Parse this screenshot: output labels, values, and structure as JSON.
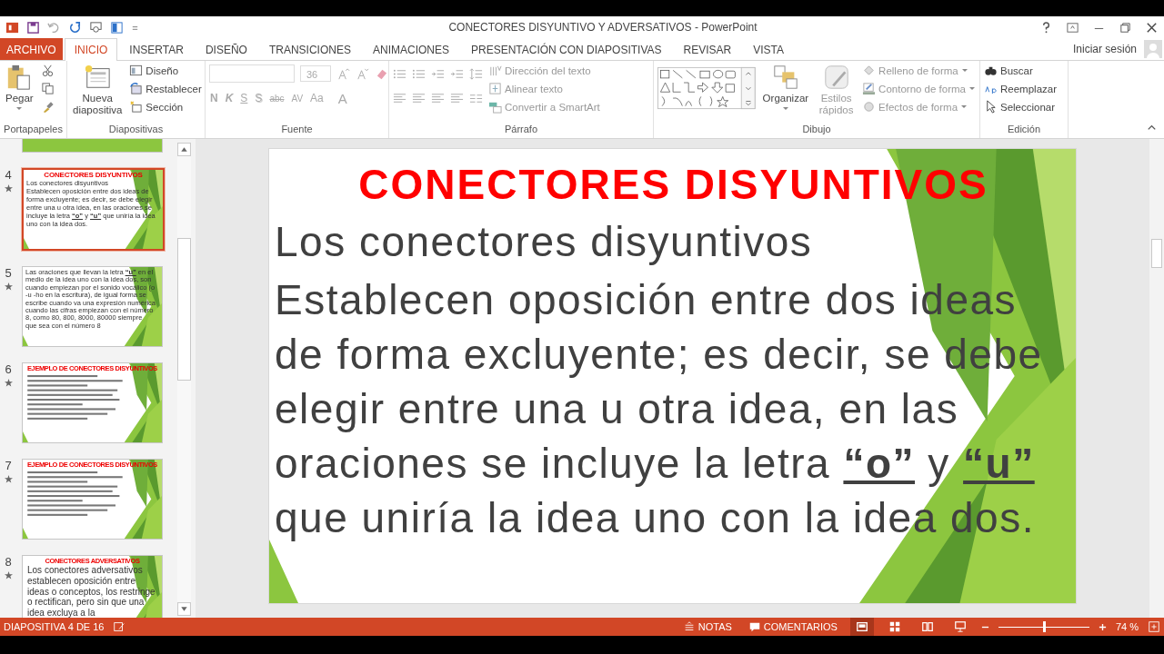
{
  "window": {
    "title": "CONECTORES DISYUNTIVO Y ADVERSATIVOS - PowerPoint",
    "sign_in": "Iniciar sesión"
  },
  "tabs": [
    {
      "label": "ARCHIVO",
      "kind": "file",
      "selected": false
    },
    {
      "label": "INICIO",
      "kind": "tab",
      "selected": true
    },
    {
      "label": "INSERTAR",
      "kind": "tab",
      "selected": false
    },
    {
      "label": "DISEÑO",
      "kind": "tab",
      "selected": false
    },
    {
      "label": "TRANSICIONES",
      "kind": "tab",
      "selected": false
    },
    {
      "label": "ANIMACIONES",
      "kind": "tab",
      "selected": false
    },
    {
      "label": "PRESENTACIÓN CON DIAPOSITIVAS",
      "kind": "tab",
      "selected": false
    },
    {
      "label": "REVISAR",
      "kind": "tab",
      "selected": false
    },
    {
      "label": "VISTA",
      "kind": "tab",
      "selected": false
    }
  ],
  "ribbon": [
    {
      "kind": "clipboard",
      "label": "Portapapeles",
      "paste": "Pegar"
    },
    {
      "kind": "slides",
      "label": "Diapositivas",
      "new_slide": "Nueva diapositiva",
      "commands": [
        "Diseño",
        "Restablecer",
        "Sección"
      ]
    },
    {
      "kind": "font",
      "label": "Fuente",
      "size": "36",
      "disabled": true,
      "buttons": [
        "N",
        "K",
        "S",
        "S",
        "abc",
        "AV",
        "Aa",
        "A"
      ]
    },
    {
      "kind": "paragraph",
      "label": "Párrafo",
      "disabled": true,
      "commands": [
        "Dirección del texto",
        "Alinear texto",
        "Convertir a SmartArt"
      ]
    },
    {
      "kind": "drawing",
      "label": "Dibujo",
      "arrange": "Organizar",
      "styles": "Estilos rápidos",
      "disabled": true,
      "commands": [
        "Relleno de forma",
        "Contorno de forma",
        "Efectos de forma"
      ]
    },
    {
      "kind": "editing",
      "label": "Edición",
      "commands": [
        "Buscar",
        "Reemplazar",
        "Seleccionar"
      ]
    }
  ],
  "thumbnails": [
    {
      "number": "4",
      "selected": true,
      "starred": true,
      "kind": "title_body",
      "title": "CONECTORES DISYUNTIVOS",
      "subtitle": "Los conectores disyuntivos",
      "body": "Establecen oposición entre dos ideas de forma excluyente; es decir, se debe elegir entre una u otra idea, en las oraciones se incluye la letra **“o”** y **“u”** que uniría la idea uno con la idea dos."
    },
    {
      "number": "5",
      "selected": false,
      "starred": true,
      "kind": "body",
      "body": "Las oraciones que llevan la letra **“u”** en el medio de la idea uno con la idea dos, son cuando empiezan por el sonido vocálico (o -u -ho en la escritura), de igual forma se escribe cuando va una expresión numérica cuando las cifras empiezan con el número 8, como 80, 800, 8000, 80000 siempre que sea con el número 8"
    },
    {
      "number": "6",
      "selected": false,
      "starred": true,
      "kind": "lines",
      "title": "EJEMPLO DE CONECTORES DISYUNTIVOS"
    },
    {
      "number": "7",
      "selected": false,
      "starred": true,
      "kind": "lines",
      "title": "EJEMPLO DE CONECTORES DISYUNTIVOS"
    },
    {
      "number": "8",
      "selected": false,
      "starred": true,
      "kind": "large_body",
      "title": "CONECTORES ADVERSATIVOS",
      "body": "Los conectores adversativos establecen oposición entre ideas o conceptos, los restringe o rectifican, pero sin que una idea excluya a la"
    }
  ],
  "slide": {
    "title": "CONECTORES DISYUNTIVOS",
    "subtitle": "Los conectores disyuntivos",
    "body": "Establecen oposición entre dos ideas de forma excluyente; es decir, se debe elegir entre una u otra idea, en las oraciones se incluye la letra **“o”** y **“u”** que uniría la idea uno con la idea dos."
  },
  "status_bar": {
    "slide_info": "DIAPOSITIVA 4 DE 16",
    "notes": "NOTAS",
    "comments": "COMENTARIOS",
    "views": [
      {
        "selected": true
      },
      {
        "selected": false
      },
      {
        "selected": false
      },
      {
        "selected": false
      }
    ],
    "zoom": {
      "level": 0.5
    },
    "zoom_text": "74 %"
  }
}
